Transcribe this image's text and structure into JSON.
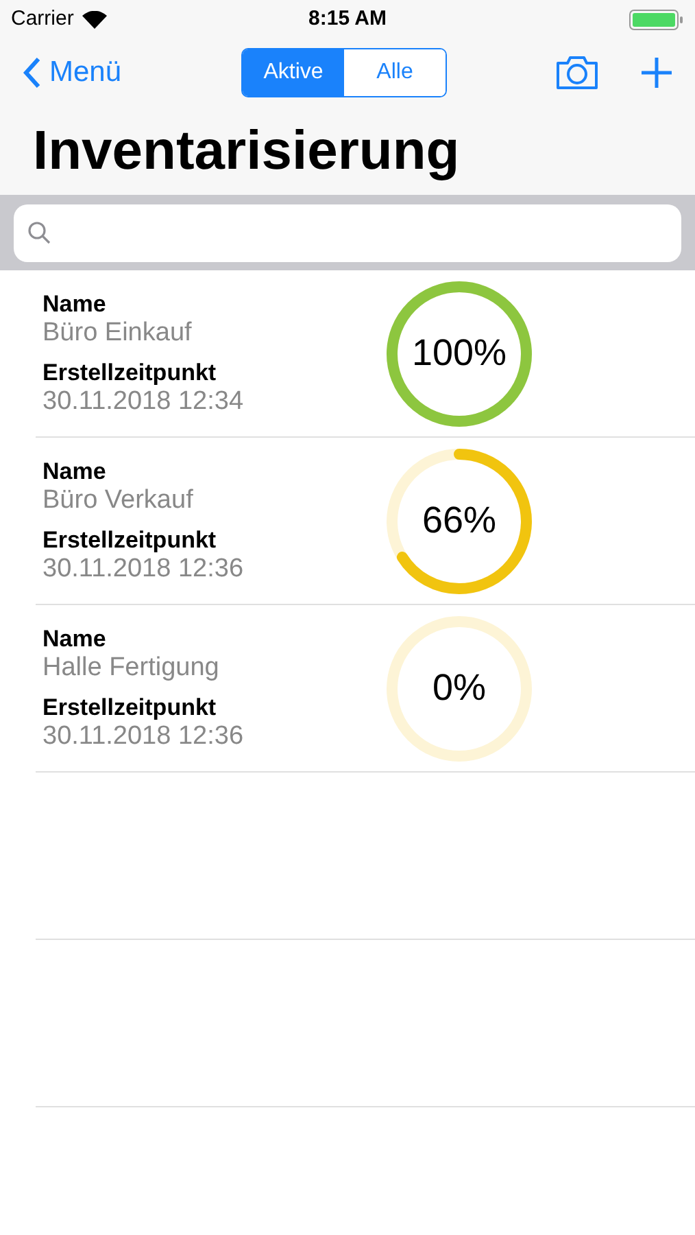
{
  "status_bar": {
    "carrier": "Carrier",
    "time": "8:15 AM"
  },
  "nav": {
    "back": "Menü",
    "tabs": [
      {
        "label": "Aktive",
        "selected": true
      },
      {
        "label": "Alle",
        "selected": false
      }
    ]
  },
  "title": "Inventarisierung",
  "inventories": [
    {
      "name_label": "Name",
      "name": "Büro Einkauf",
      "created_label": "Erstellzeitpunkt",
      "created": "30.11.2018 12:34",
      "percent": "100%",
      "level": 1
    },
    {
      "name_label": "Name",
      "name": "Büro Verkauf",
      "created_label": "Erstellzeitpunkt",
      "created": "30.11.2018 12:36",
      "percent": "66%",
      "level": 0.66
    },
    {
      "name_label": "Name",
      "name": "Halle Fertigung",
      "created_label": "Erstellzeitpunkt",
      "created": "30.11.2018 12:36",
      "percent": "0%",
      "level": 0
    }
  ]
}
